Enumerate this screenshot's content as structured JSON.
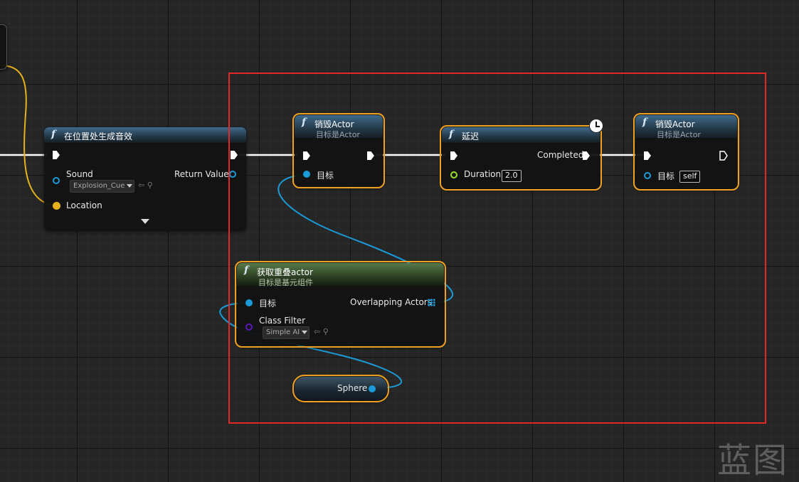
{
  "colors": {
    "exec_wire": "#ffffff",
    "object_wire": "#1a9bd8",
    "vector_wire": "#e6b11b",
    "class_pin": "#5a1ab8",
    "selection_outline": "#f0a020",
    "annotation_box": "#e02a2a"
  },
  "nodes": {
    "spawn_sound": {
      "icon": "function-icon",
      "title": "在位置处生成音效",
      "pins": {
        "sound_label": "Sound",
        "sound_value": "Explosion_Cue",
        "return_label": "Return Value",
        "location_label": "Location"
      }
    },
    "destroy1": {
      "icon": "function-icon",
      "title": "销毁Actor",
      "subtitle": "目标是Actor",
      "pins": {
        "target_label": "目标"
      }
    },
    "delay": {
      "icon": "function-icon",
      "title": "延迟",
      "latent_icon": "clock-icon",
      "pins": {
        "completed_label": "Completed",
        "duration_label": "Duration",
        "duration_value": "2.0"
      }
    },
    "destroy2": {
      "icon": "function-icon",
      "title": "销毁Actor",
      "subtitle": "目标是Actor",
      "pins": {
        "target_label": "目标",
        "target_value": "self"
      }
    },
    "get_overlap": {
      "icon": "function-icon",
      "title": "获取重叠actor",
      "subtitle": "目标是基元组件",
      "pins": {
        "target_label": "目标",
        "output_label": "Overlapping Actors",
        "class_filter_label": "Class Filter",
        "class_filter_value": "Simple AI"
      }
    },
    "sphere": {
      "label": "Sphere"
    }
  },
  "watermark": "蓝图"
}
